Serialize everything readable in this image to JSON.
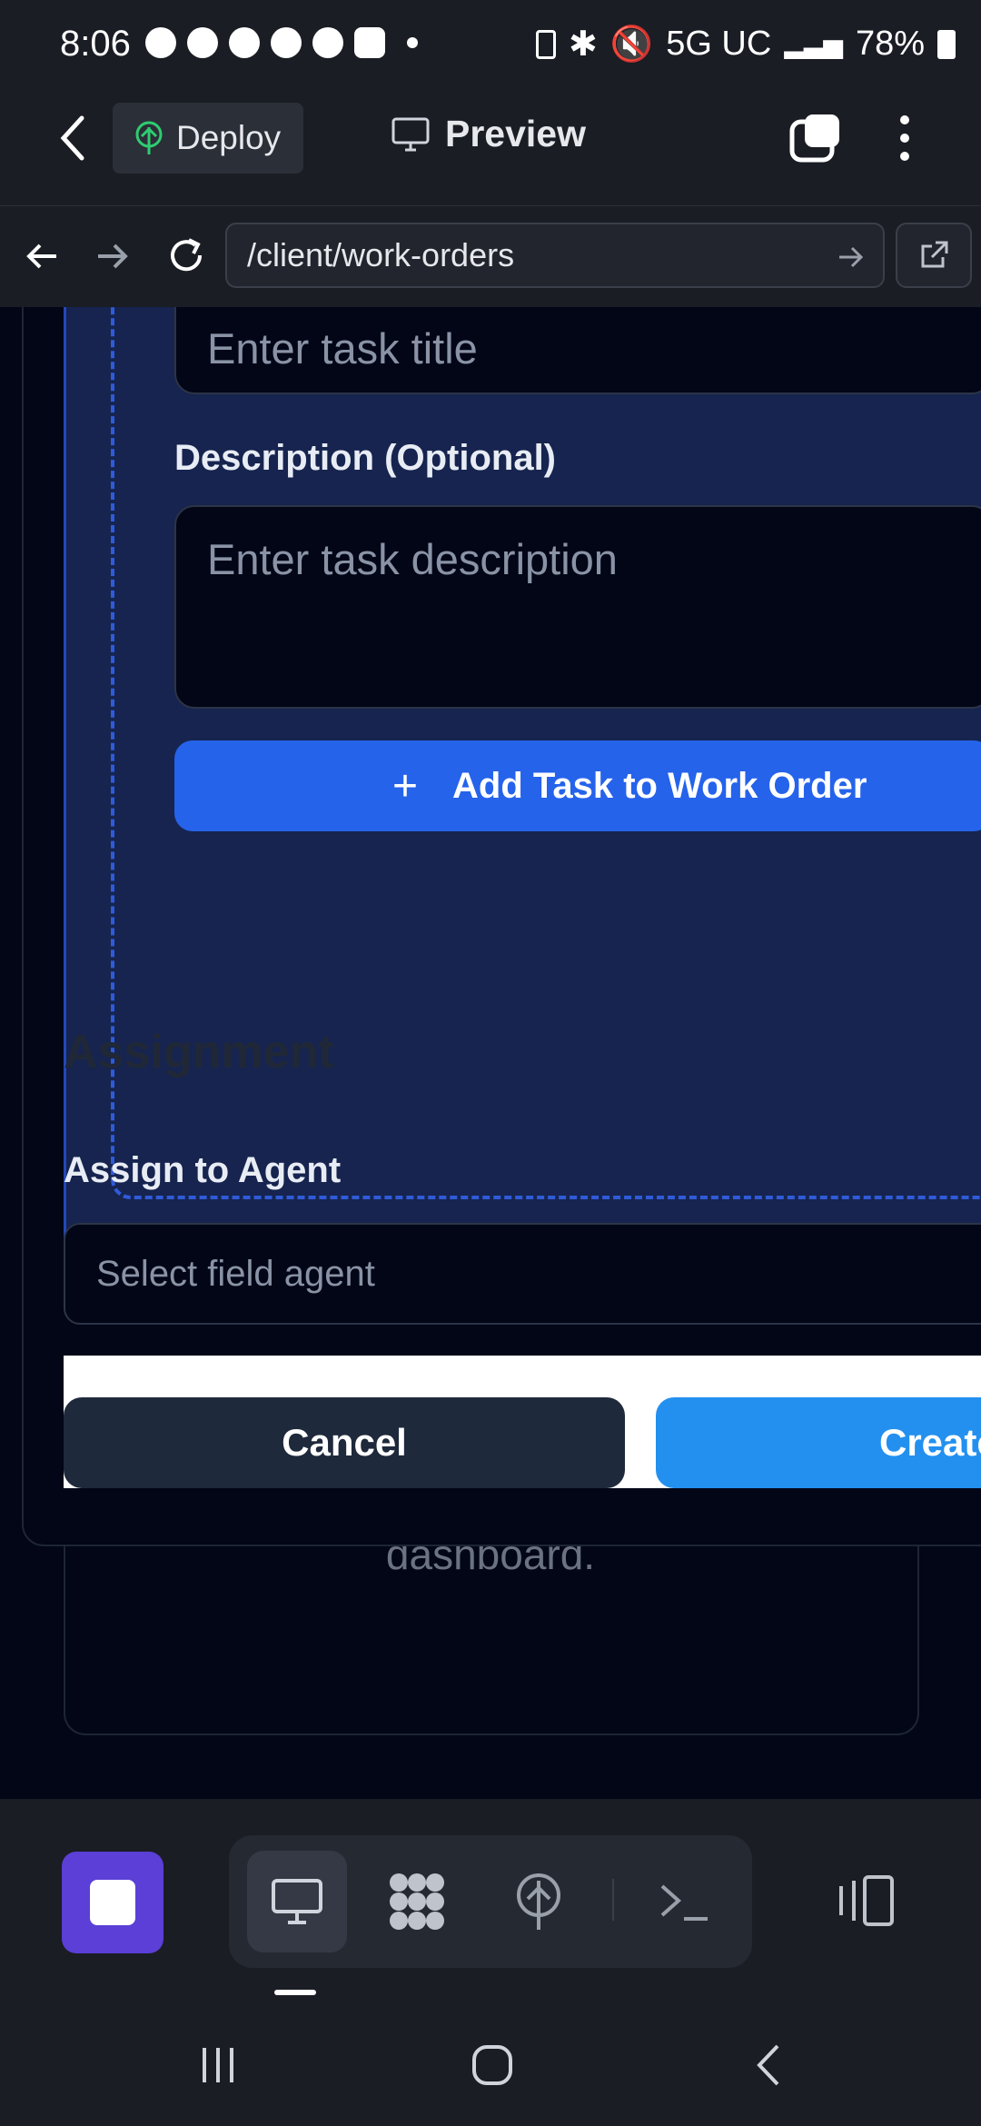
{
  "status_bar": {
    "time": "8:06",
    "network": "5G UC",
    "battery": "78%"
  },
  "header": {
    "deploy_label": "Deploy",
    "preview_label": "Preview"
  },
  "url_bar": {
    "path": "/client/work-orders"
  },
  "form": {
    "task_title_placeholder": "Enter task title",
    "description_label": "Description (Optional)",
    "description_placeholder": "Enter task description",
    "add_task_label": "Add Task to Work Order",
    "assignment_heading": "Assignment",
    "assign_label": "Assign to Agent",
    "agent_placeholder": "Select field agent",
    "cancel_label": "Cancel",
    "create_label": "Create"
  },
  "background": {
    "dashboard_text": "dashboard."
  },
  "colors": {
    "accent_blue": "#2563eb",
    "create_blue": "#2390f0",
    "stop_purple": "#5b3fd6"
  },
  "toolbar": {
    "tools": [
      "desktop-icon",
      "apps-icon",
      "deploy-icon",
      "terminal-icon"
    ]
  }
}
